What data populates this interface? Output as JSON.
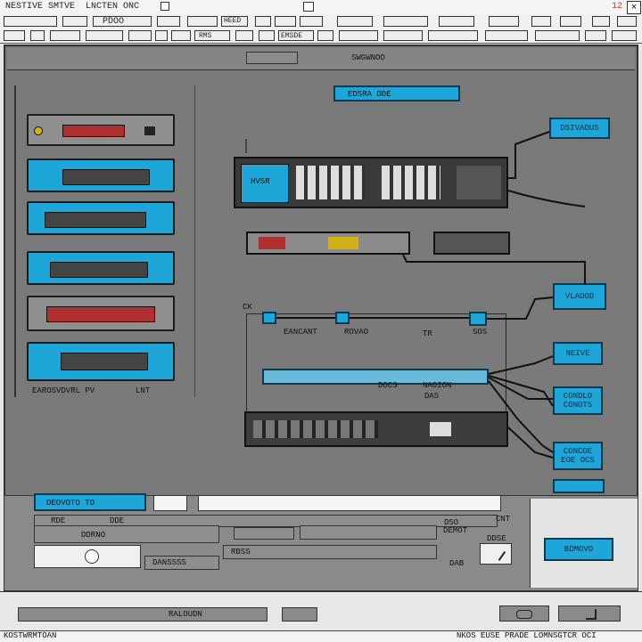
{
  "window": {
    "title_left": "NESTIVE SMTVE",
    "title_mid": "LNCTEN ONC",
    "close_glyph": "×",
    "top_right_mark": "12"
  },
  "toolbar": {
    "item_2": "PDOO",
    "item_3": "HEED",
    "row2_label_1": "RMS",
    "row2_label_2": "EMSDE"
  },
  "canvas": {
    "top_label": "SWGWNOO",
    "topbar_label": "EDSRA DDE"
  },
  "left_panel": {
    "footer_left": "EAROSVDVRL PV",
    "footer_right": "LNT"
  },
  "center": {
    "router_screen": "HVSR",
    "label_ck": "CK",
    "label_eancant": "EANCANT",
    "label_rovao": "ROVAO",
    "label_rev": "TR",
    "label_sos": "SOS",
    "label_mid_1": "DOCS",
    "label_mid_2": "NAOION",
    "label_mid_3": "DAS"
  },
  "right_buttons": [
    {
      "label": "DSIVAOUS"
    },
    {
      "label": "VLAOOD"
    },
    {
      "label": "NEIVE"
    },
    {
      "label": "CONDLO CONOTS"
    },
    {
      "label": "CONCOE EOE OCS"
    }
  ],
  "bottom": {
    "tab_blue": "DEOVOTO TO",
    "row1_label": "RDE",
    "row1_label2": "DDE",
    "row2_label": "DDRNO",
    "row2_label2": "DEMOT",
    "row3_label": "DANSSSS",
    "row3_label2": "RBSS",
    "right_small_1": "DSO",
    "right_small_2": "CNT",
    "right_small_3": "DDSE",
    "right_small_4": "DAB",
    "right_button": "BDMOVO",
    "status_label": "RALOUDN",
    "footer_left": "KOSTWRMTOAN",
    "footer_right": "NKOS EUSE PRADE LOMNSGTCR OCI"
  },
  "colors": {
    "accent": "#1fa6d8",
    "canvas": "#7a7a7a",
    "chrome": "#e6e6e6"
  }
}
